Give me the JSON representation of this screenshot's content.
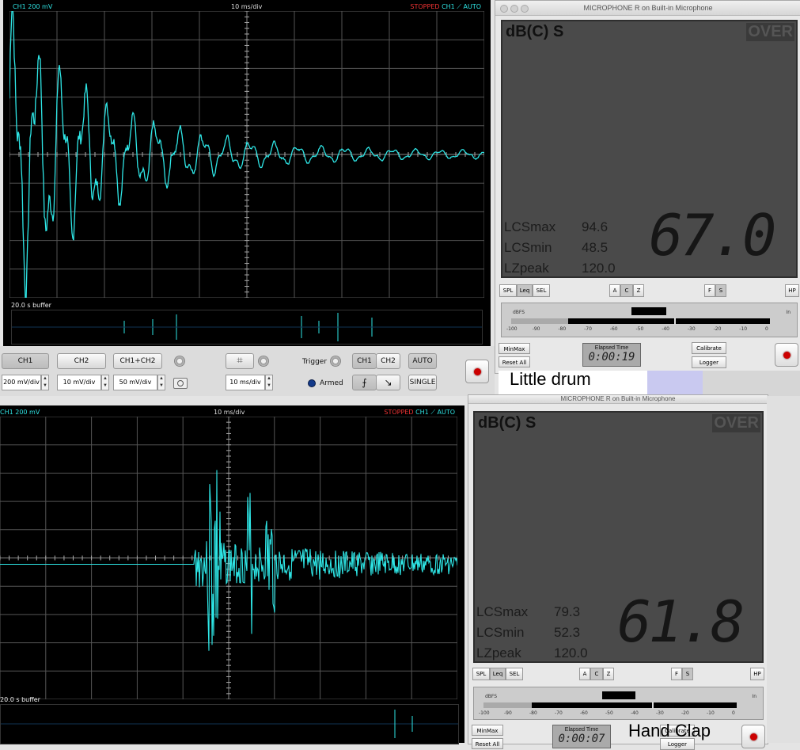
{
  "top_scope": {
    "channel": "CH1 200 mV",
    "timebase": "10 ms/div",
    "status": "STOPPED",
    "trigger_ch": "CH1",
    "trigger_mode": "AUTO",
    "buffer": "20.0 s buffer"
  },
  "controls": {
    "ch1": "CH1",
    "ch2": "CH2",
    "ch1ch2": "CH1+CH2",
    "ch1_scale": "200 mV/div",
    "ch2_scale": "10 mV/div",
    "sum_scale": "50 mV/div",
    "time_scale": "10 ms/div",
    "trigger_label": "Trigger",
    "armed": "Armed",
    "trig_ch1": "CH1",
    "trig_ch2": "CH2",
    "auto": "AUTO",
    "single": "SINGLE"
  },
  "meter_top": {
    "title": "MICROPHONE R on Built-in Microphone",
    "mode": "dB(C) S",
    "over": "OVER",
    "stats": [
      {
        "label": "LCSmax",
        "value": "94.6"
      },
      {
        "label": "LCSmin",
        "value": "48.5"
      },
      {
        "label": "LZpeak",
        "value": "120.0"
      }
    ],
    "reading": "67.0",
    "elapsed_label": "Elapsed Time",
    "elapsed": "0:00:19",
    "level_fraction": 0.22
  },
  "meter_bottom": {
    "title": "MICROPHONE R on Built-in Microphone",
    "mode": "dB(C) S",
    "over": "OVER",
    "stats": [
      {
        "label": "LCSmax",
        "value": "79.3"
      },
      {
        "label": "LCSmin",
        "value": "52.3"
      },
      {
        "label": "LZpeak",
        "value": "120.0"
      }
    ],
    "reading": "61.8",
    "elapsed_label": "Elapsed Time",
    "elapsed": "0:00:07",
    "level_fraction": 0.19
  },
  "meter_buttons": {
    "spl": "SPL",
    "leq": "Leq",
    "sel": "SEL",
    "a": "A",
    "c": "C",
    "z": "Z",
    "f": "F",
    "s": "S",
    "hp": "HP",
    "dbfs": "dBFS",
    "in": "In",
    "minmax": "MinMax",
    "reset": "Reset All",
    "calibrate": "Calibrate",
    "logger": "Logger"
  },
  "dbfs_ticks": [
    "-100",
    "-90",
    "-80",
    "-70",
    "-60",
    "-50",
    "-40",
    "-30",
    "-20",
    "-10",
    "0"
  ],
  "notes": {
    "little_drum": "Little drum",
    "hand_clap": "Hand Clap"
  },
  "colors": {
    "trace": "#2ee6e6",
    "stopped": "#ee3333"
  }
}
